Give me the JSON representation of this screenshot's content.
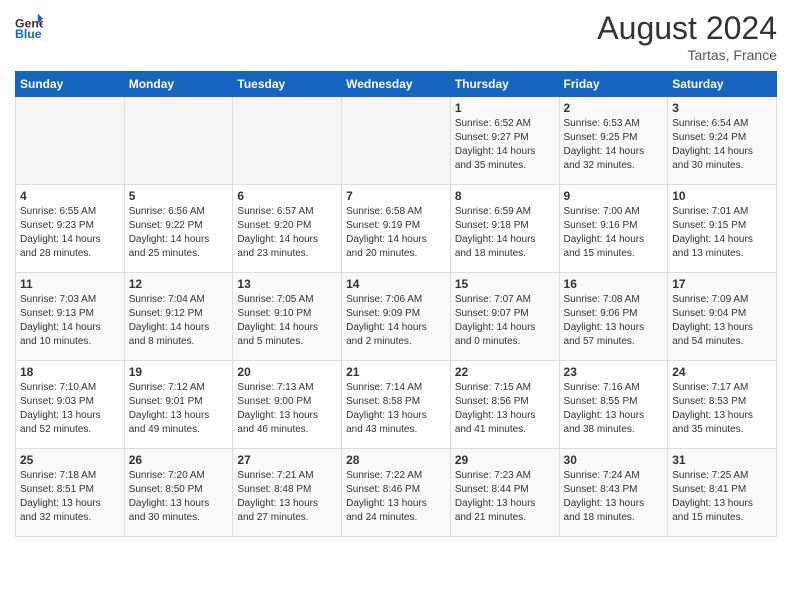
{
  "header": {
    "logo_general": "General",
    "logo_blue": "Blue",
    "month_year": "August 2024",
    "location": "Tartas, France"
  },
  "weekdays": [
    "Sunday",
    "Monday",
    "Tuesday",
    "Wednesday",
    "Thursday",
    "Friday",
    "Saturday"
  ],
  "weeks": [
    [
      {
        "day": "",
        "sunrise": "",
        "sunset": "",
        "daylight": ""
      },
      {
        "day": "",
        "sunrise": "",
        "sunset": "",
        "daylight": ""
      },
      {
        "day": "",
        "sunrise": "",
        "sunset": "",
        "daylight": ""
      },
      {
        "day": "",
        "sunrise": "",
        "sunset": "",
        "daylight": ""
      },
      {
        "day": "1",
        "sunrise": "Sunrise: 6:52 AM",
        "sunset": "Sunset: 9:27 PM",
        "daylight": "Daylight: 14 hours and 35 minutes."
      },
      {
        "day": "2",
        "sunrise": "Sunrise: 6:53 AM",
        "sunset": "Sunset: 9:25 PM",
        "daylight": "Daylight: 14 hours and 32 minutes."
      },
      {
        "day": "3",
        "sunrise": "Sunrise: 6:54 AM",
        "sunset": "Sunset: 9:24 PM",
        "daylight": "Daylight: 14 hours and 30 minutes."
      }
    ],
    [
      {
        "day": "4",
        "sunrise": "Sunrise: 6:55 AM",
        "sunset": "Sunset: 9:23 PM",
        "daylight": "Daylight: 14 hours and 28 minutes."
      },
      {
        "day": "5",
        "sunrise": "Sunrise: 6:56 AM",
        "sunset": "Sunset: 9:22 PM",
        "daylight": "Daylight: 14 hours and 25 minutes."
      },
      {
        "day": "6",
        "sunrise": "Sunrise: 6:57 AM",
        "sunset": "Sunset: 9:20 PM",
        "daylight": "Daylight: 14 hours and 23 minutes."
      },
      {
        "day": "7",
        "sunrise": "Sunrise: 6:58 AM",
        "sunset": "Sunset: 9:19 PM",
        "daylight": "Daylight: 14 hours and 20 minutes."
      },
      {
        "day": "8",
        "sunrise": "Sunrise: 6:59 AM",
        "sunset": "Sunset: 9:18 PM",
        "daylight": "Daylight: 14 hours and 18 minutes."
      },
      {
        "day": "9",
        "sunrise": "Sunrise: 7:00 AM",
        "sunset": "Sunset: 9:16 PM",
        "daylight": "Daylight: 14 hours and 15 minutes."
      },
      {
        "day": "10",
        "sunrise": "Sunrise: 7:01 AM",
        "sunset": "Sunset: 9:15 PM",
        "daylight": "Daylight: 14 hours and 13 minutes."
      }
    ],
    [
      {
        "day": "11",
        "sunrise": "Sunrise: 7:03 AM",
        "sunset": "Sunset: 9:13 PM",
        "daylight": "Daylight: 14 hours and 10 minutes."
      },
      {
        "day": "12",
        "sunrise": "Sunrise: 7:04 AM",
        "sunset": "Sunset: 9:12 PM",
        "daylight": "Daylight: 14 hours and 8 minutes."
      },
      {
        "day": "13",
        "sunrise": "Sunrise: 7:05 AM",
        "sunset": "Sunset: 9:10 PM",
        "daylight": "Daylight: 14 hours and 5 minutes."
      },
      {
        "day": "14",
        "sunrise": "Sunrise: 7:06 AM",
        "sunset": "Sunset: 9:09 PM",
        "daylight": "Daylight: 14 hours and 2 minutes."
      },
      {
        "day": "15",
        "sunrise": "Sunrise: 7:07 AM",
        "sunset": "Sunset: 9:07 PM",
        "daylight": "Daylight: 14 hours and 0 minutes."
      },
      {
        "day": "16",
        "sunrise": "Sunrise: 7:08 AM",
        "sunset": "Sunset: 9:06 PM",
        "daylight": "Daylight: 13 hours and 57 minutes."
      },
      {
        "day": "17",
        "sunrise": "Sunrise: 7:09 AM",
        "sunset": "Sunset: 9:04 PM",
        "daylight": "Daylight: 13 hours and 54 minutes."
      }
    ],
    [
      {
        "day": "18",
        "sunrise": "Sunrise: 7:10 AM",
        "sunset": "Sunset: 9:03 PM",
        "daylight": "Daylight: 13 hours and 52 minutes."
      },
      {
        "day": "19",
        "sunrise": "Sunrise: 7:12 AM",
        "sunset": "Sunset: 9:01 PM",
        "daylight": "Daylight: 13 hours and 49 minutes."
      },
      {
        "day": "20",
        "sunrise": "Sunrise: 7:13 AM",
        "sunset": "Sunset: 9:00 PM",
        "daylight": "Daylight: 13 hours and 46 minutes."
      },
      {
        "day": "21",
        "sunrise": "Sunrise: 7:14 AM",
        "sunset": "Sunset: 8:58 PM",
        "daylight": "Daylight: 13 hours and 43 minutes."
      },
      {
        "day": "22",
        "sunrise": "Sunrise: 7:15 AM",
        "sunset": "Sunset: 8:56 PM",
        "daylight": "Daylight: 13 hours and 41 minutes."
      },
      {
        "day": "23",
        "sunrise": "Sunrise: 7:16 AM",
        "sunset": "Sunset: 8:55 PM",
        "daylight": "Daylight: 13 hours and 38 minutes."
      },
      {
        "day": "24",
        "sunrise": "Sunrise: 7:17 AM",
        "sunset": "Sunset: 8:53 PM",
        "daylight": "Daylight: 13 hours and 35 minutes."
      }
    ],
    [
      {
        "day": "25",
        "sunrise": "Sunrise: 7:18 AM",
        "sunset": "Sunset: 8:51 PM",
        "daylight": "Daylight: 13 hours and 32 minutes."
      },
      {
        "day": "26",
        "sunrise": "Sunrise: 7:20 AM",
        "sunset": "Sunset: 8:50 PM",
        "daylight": "Daylight: 13 hours and 30 minutes."
      },
      {
        "day": "27",
        "sunrise": "Sunrise: 7:21 AM",
        "sunset": "Sunset: 8:48 PM",
        "daylight": "Daylight: 13 hours and 27 minutes."
      },
      {
        "day": "28",
        "sunrise": "Sunrise: 7:22 AM",
        "sunset": "Sunset: 8:46 PM",
        "daylight": "Daylight: 13 hours and 24 minutes."
      },
      {
        "day": "29",
        "sunrise": "Sunrise: 7:23 AM",
        "sunset": "Sunset: 8:44 PM",
        "daylight": "Daylight: 13 hours and 21 minutes."
      },
      {
        "day": "30",
        "sunrise": "Sunrise: 7:24 AM",
        "sunset": "Sunset: 8:43 PM",
        "daylight": "Daylight: 13 hours and 18 minutes."
      },
      {
        "day": "31",
        "sunrise": "Sunrise: 7:25 AM",
        "sunset": "Sunset: 8:41 PM",
        "daylight": "Daylight: 13 hours and 15 minutes."
      }
    ]
  ]
}
